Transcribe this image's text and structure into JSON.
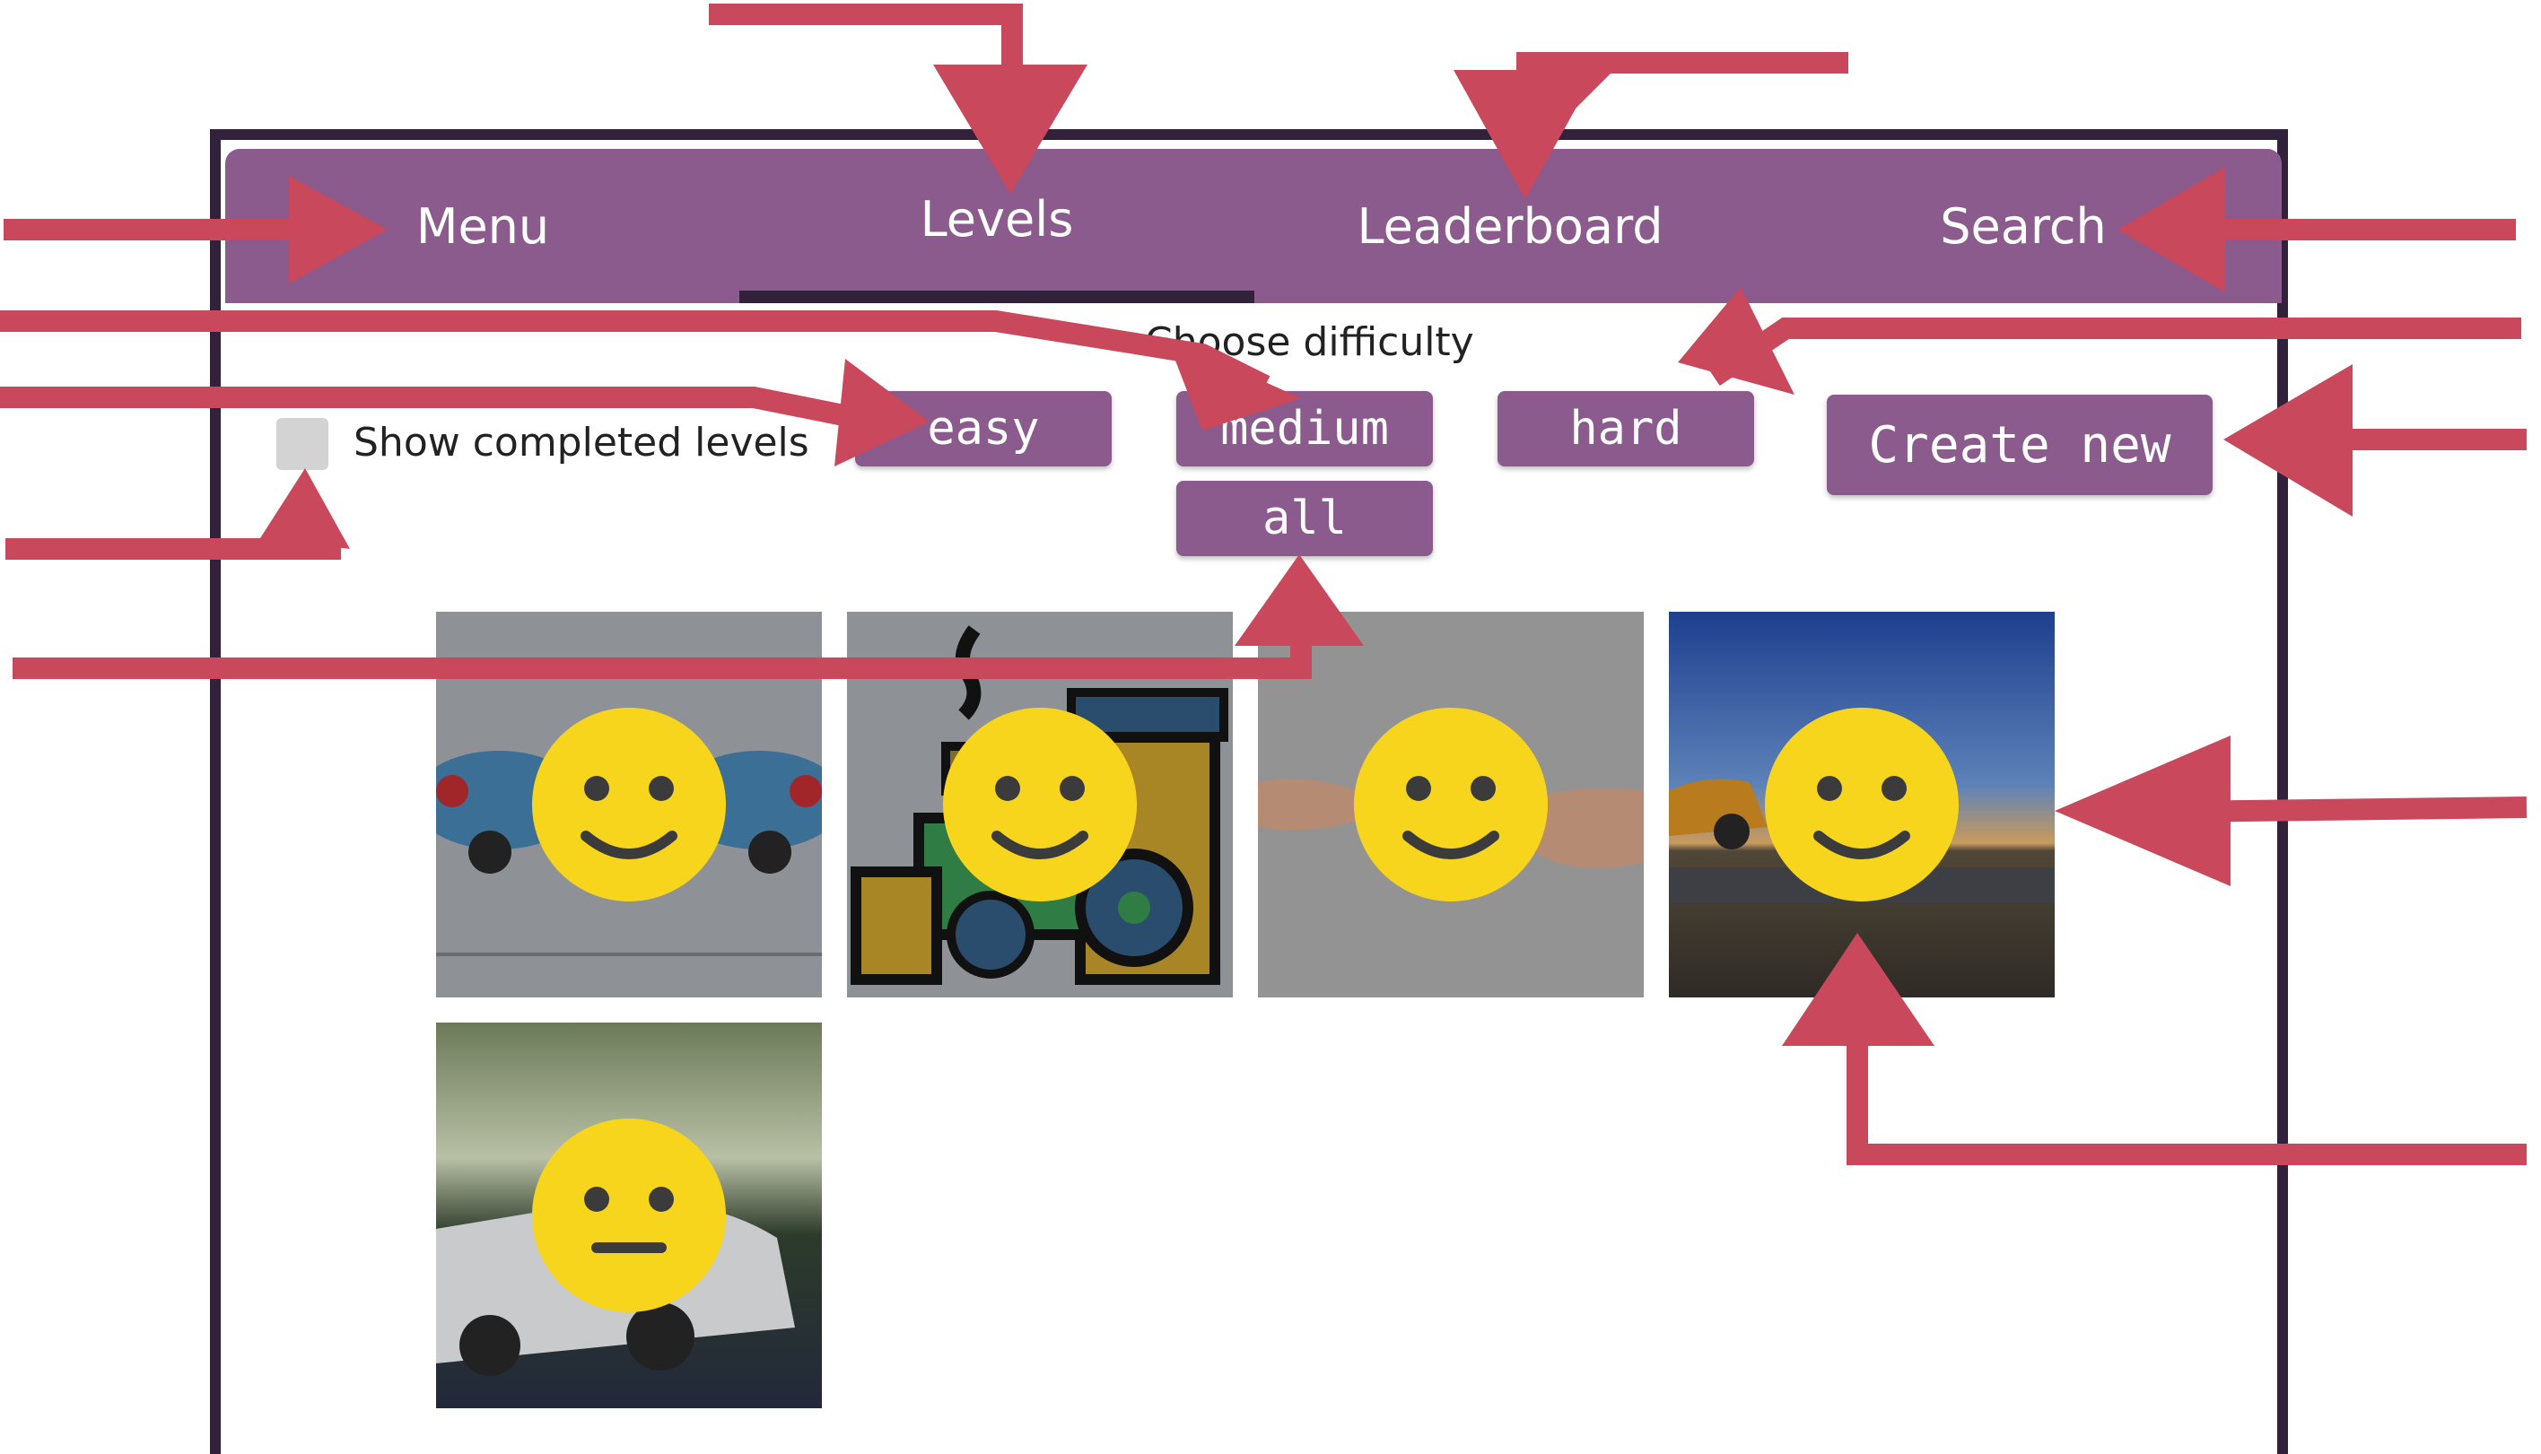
{
  "nav": {
    "menu": "Menu",
    "levels": "Levels",
    "leaderboard": "Leaderboard",
    "search": "Search",
    "active_tab": "Levels"
  },
  "filters": {
    "show_completed_label": "Show completed levels",
    "show_completed_checked": false,
    "choose_difficulty": "Choose difficulty",
    "easy": "easy",
    "medium": "medium",
    "hard": "hard",
    "all": "all"
  },
  "actions": {
    "create_new": "Create new"
  },
  "levels": [
    {
      "image": "toy-cars",
      "status": "smiley-icon"
    },
    {
      "image": "toy-train",
      "status": "smiley-icon"
    },
    {
      "image": "handshake",
      "status": "smiley-icon"
    },
    {
      "image": "sports-car-sunset",
      "status": "smiley-icon"
    },
    {
      "image": "silver-hatchback",
      "status": "neutral-face-icon"
    }
  ],
  "colors": {
    "accent": "#8b5b8e",
    "frame": "#32213b",
    "annotation_arrow": "#c9485b",
    "face": "#f7d51d"
  }
}
